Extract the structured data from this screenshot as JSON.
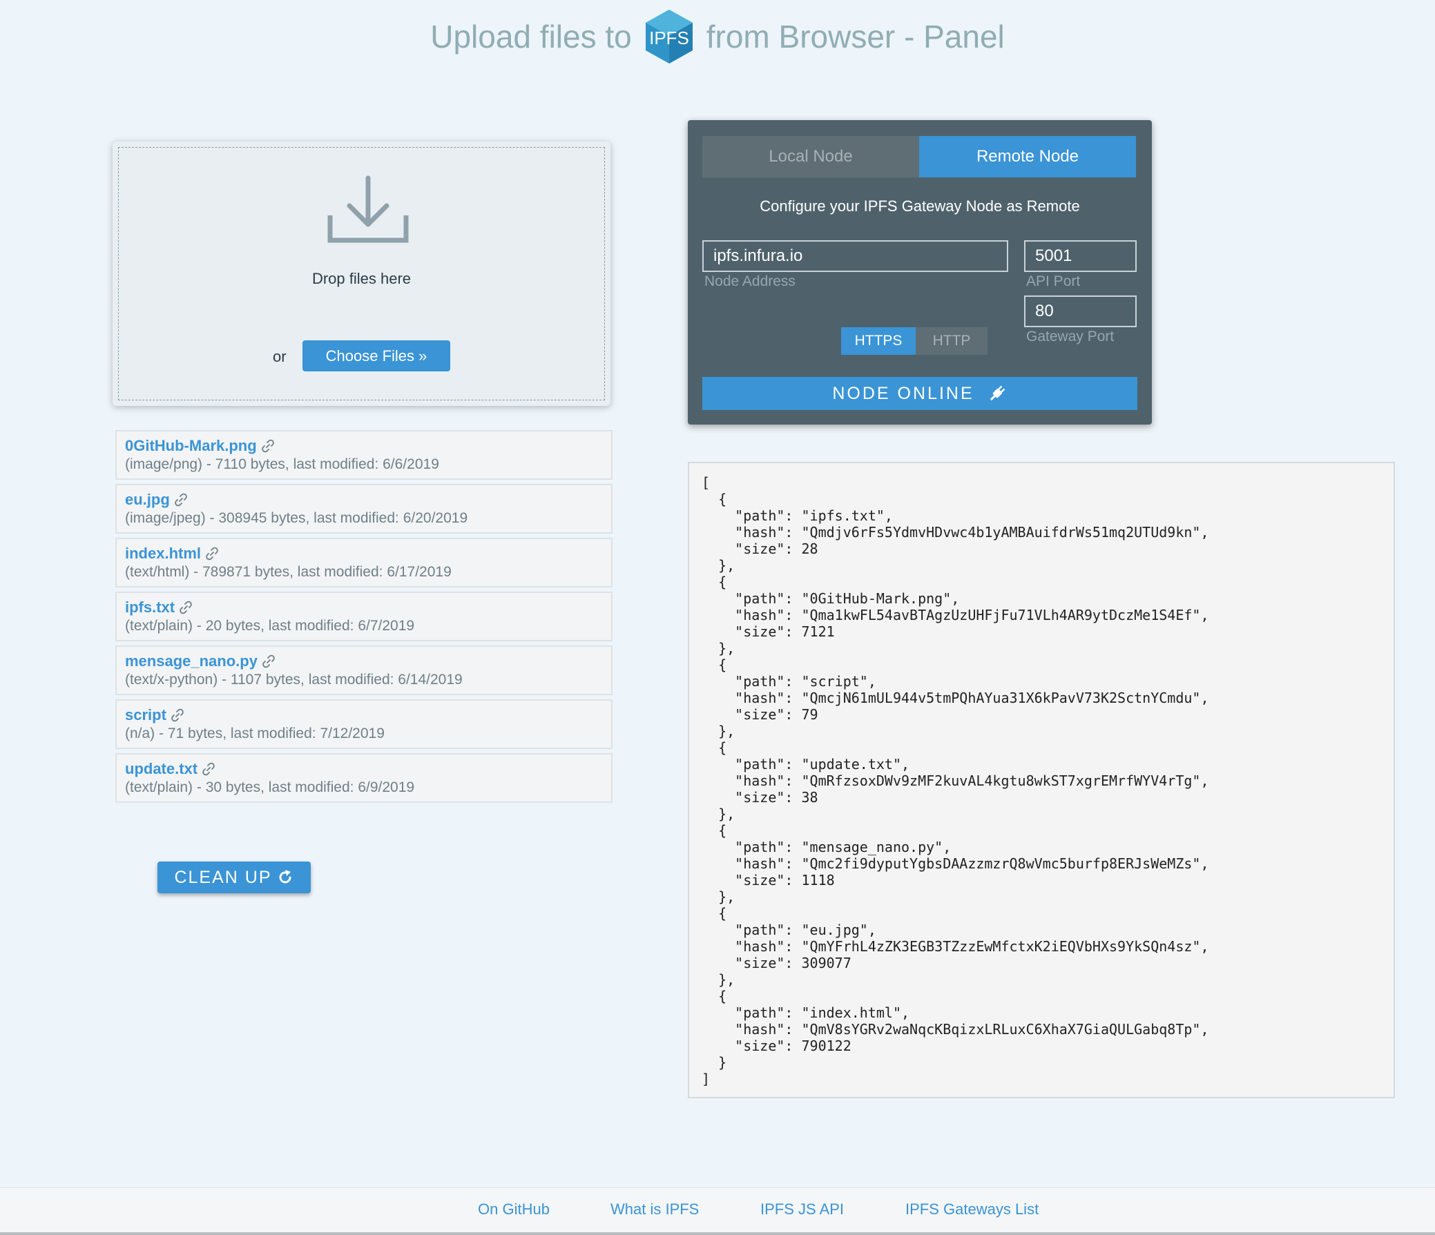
{
  "header": {
    "title_before": "Upload files to",
    "logo_text": "IPFS",
    "title_after": "from Browser - Panel"
  },
  "dropzone": {
    "drop_text": "Drop files here",
    "or_label": "or",
    "choose_button": "Choose Files »"
  },
  "files": [
    {
      "name": "0GitHub-Mark.png",
      "meta": "(image/png) - 7110 bytes, last modified: 6/6/2019"
    },
    {
      "name": "eu.jpg",
      "meta": "(image/jpeg) - 308945 bytes, last modified: 6/20/2019"
    },
    {
      "name": "index.html",
      "meta": "(text/html) - 789871 bytes, last modified: 6/17/2019"
    },
    {
      "name": "ipfs.txt",
      "meta": "(text/plain) - 20 bytes, last modified: 6/7/2019"
    },
    {
      "name": "mensage_nano.py",
      "meta": "(text/x-python) - 1107 bytes, last modified: 6/14/2019"
    },
    {
      "name": "script",
      "meta": "(n/a) - 71 bytes, last modified: 7/12/2019"
    },
    {
      "name": "update.txt",
      "meta": "(text/plain) - 30 bytes, last modified: 6/9/2019"
    }
  ],
  "cleanup_button": "CLEAN UP",
  "panel": {
    "tab_local": "Local Node",
    "tab_remote": "Remote Node",
    "config_text": "Configure your IPFS Gateway Node as Remote",
    "node_address_value": "ipfs.infura.io",
    "node_address_label": "Node Address",
    "api_port_value": "5001",
    "api_port_label": "API Port",
    "gateway_port_value": "80",
    "gateway_port_label": "Gateway Port",
    "proto_https": "HTTPS",
    "proto_http": "HTTP",
    "status": "NODE ONLINE"
  },
  "json_output": "[\n  {\n    \"path\": \"ipfs.txt\",\n    \"hash\": \"Qmdjv6rFs5YdmvHDvwc4b1yAMBAuifdrWs51mq2UTUd9kn\",\n    \"size\": 28\n  },\n  {\n    \"path\": \"0GitHub-Mark.png\",\n    \"hash\": \"Qma1kwFL54avBTAgzUzUHFjFu71VLh4AR9ytDczMe1S4Ef\",\n    \"size\": 7121\n  },\n  {\n    \"path\": \"script\",\n    \"hash\": \"QmcjN61mUL944v5tmPQhAYua31X6kPavV73K2SctnYCmdu\",\n    \"size\": 79\n  },\n  {\n    \"path\": \"update.txt\",\n    \"hash\": \"QmRfzsoxDWv9zMF2kuvAL4kgtu8wkST7xgrEMrfWYV4rTg\",\n    \"size\": 38\n  },\n  {\n    \"path\": \"mensage_nano.py\",\n    \"hash\": \"Qmc2fi9dyputYgbsDAAzzmzrQ8wVmc5burfp8ERJsWeMZs\",\n    \"size\": 1118\n  },\n  {\n    \"path\": \"eu.jpg\",\n    \"hash\": \"QmYFrhL4zZK3EGB3TZzzEwMfctxK2iEQVbHXs9YkSQn4sz\",\n    \"size\": 309077\n  },\n  {\n    \"path\": \"index.html\",\n    \"hash\": \"QmV8sYGRv2waNqcKBqizxLRLuxC6XhaX7GiaQULGabq8Tp\",\n    \"size\": 790122\n  }\n]",
  "footer": {
    "link_github": "On GitHub",
    "link_what": "What is IPFS",
    "link_api": "IPFS JS API",
    "link_gateways": "IPFS Gateways List"
  },
  "colors": {
    "accent": "#3a94d6",
    "panel_bg": "#4f626c",
    "page_bg": "#edf4fa"
  }
}
